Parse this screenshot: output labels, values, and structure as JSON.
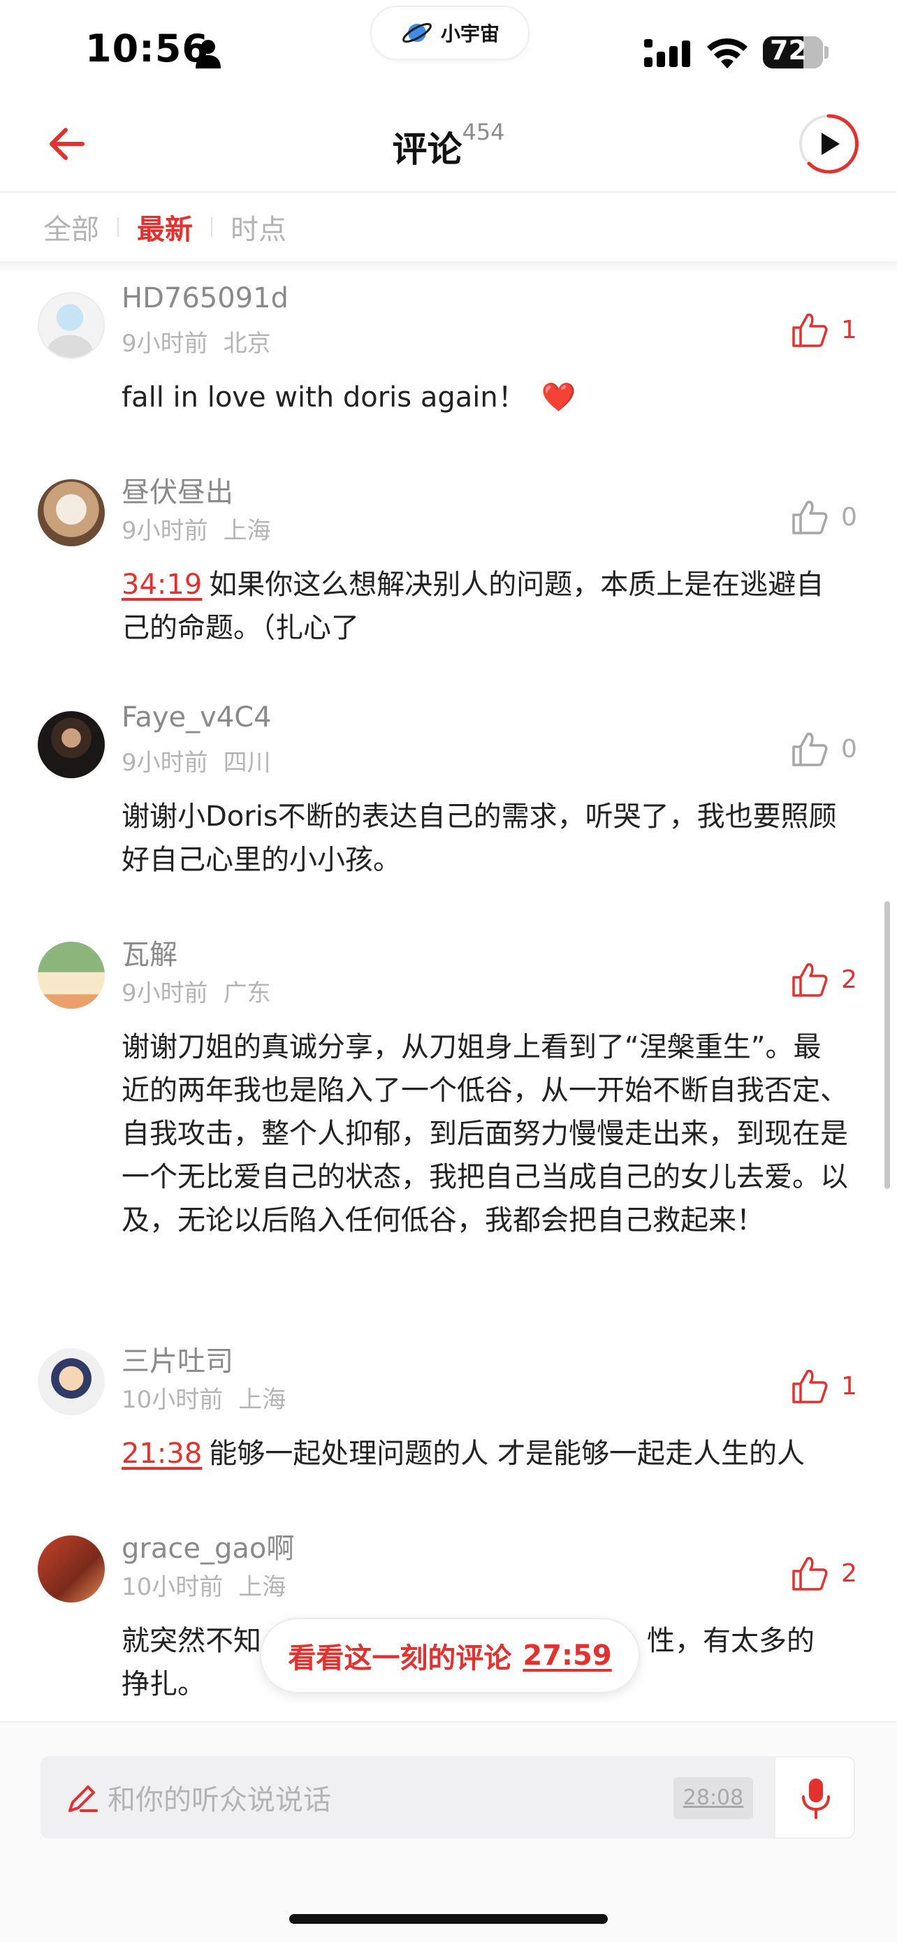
{
  "status_bar": {
    "time": "10:56",
    "battery": "72",
    "app_name": "小宇宙"
  },
  "nav": {
    "title": "评论",
    "count": "454"
  },
  "tabs": [
    {
      "label": "全部",
      "active": false
    },
    {
      "label": "最新",
      "active": true
    },
    {
      "label": "时点",
      "active": false
    }
  ],
  "comments": [
    {
      "username": "HD765091d",
      "time": "9小时前",
      "location": "北京",
      "likes": "1",
      "liked": true,
      "timestamp": "",
      "text": "fall in love with doris again！",
      "emoji": "❤️"
    },
    {
      "username": "昼伏昼出",
      "time": "9小时前",
      "location": "上海",
      "likes": "0",
      "liked": false,
      "timestamp": "34:19",
      "text": "如果你这么想解决别人的问题，本质上是在逃避自己的命题。（扎心了"
    },
    {
      "username": "Faye_v4C4",
      "time": "9小时前",
      "location": "四川",
      "likes": "0",
      "liked": false,
      "timestamp": "",
      "text": "谢谢小Doris不断的表达自己的需求，听哭了，我也要照顾好自己心里的小小孩。"
    },
    {
      "username": "瓦解",
      "time": "9小时前",
      "location": "广东",
      "likes": "2",
      "liked": true,
      "timestamp": "",
      "text": "谢谢刀姐的真诚分享，从刀姐身上看到了“涅槃重生”。最近的两年我也是陷入了一个低谷，从一开始不断自我否定、自我攻击，整个人抑郁，到后面努力慢慢走出来，到现在是一个无比爱自己的状态，我把自己当成自己的女儿去爱。以及，无论以后陷入任何低谷，我都会把自己救起来！"
    },
    {
      "username": "三片吐司",
      "time": "10小时前",
      "location": "上海",
      "likes": "1",
      "liked": true,
      "timestamp": "21:38",
      "text": "能够一起处理问题的人 才是能够一起走人生的人"
    },
    {
      "username": "grace_gao啊",
      "time": "10小时前",
      "location": "上海",
      "likes": "2",
      "liked": true,
      "timestamp": "",
      "text_start": "就突然不知",
      "text_end": "性，有太多的挣扎。"
    }
  ],
  "floating_pill": {
    "label": "看看这一刻的评论",
    "timestamp": "27:59"
  },
  "input": {
    "placeholder": "和你的听众说说话",
    "timestamp": "28:08"
  },
  "colors": {
    "accent": "#e2312f",
    "muted": "#b4b4b4"
  },
  "icons": [
    "person-icon",
    "planet-logo-icon",
    "signal-icon",
    "wifi-icon",
    "back-arrow-icon",
    "play-icon",
    "thumb-up-icon",
    "pen-icon",
    "mic-icon"
  ]
}
